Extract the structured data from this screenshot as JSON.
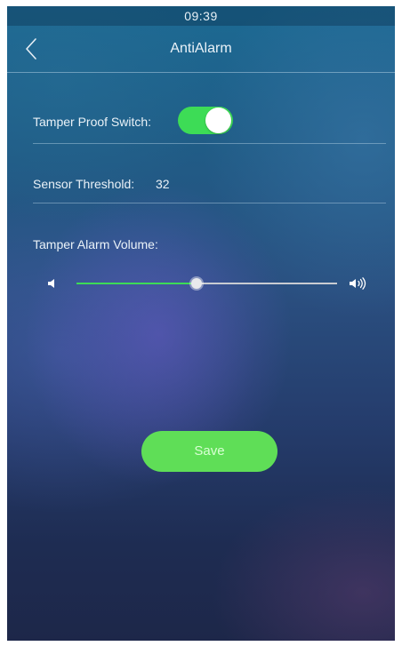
{
  "status_bar": {
    "time": "09:39"
  },
  "header": {
    "title": "AntiAlarm",
    "back_icon": "chevron-left-icon"
  },
  "tamper": {
    "label": "Tamper Proof Switch:",
    "enabled": true
  },
  "threshold": {
    "label": "Sensor Threshold:",
    "value": "32"
  },
  "volume": {
    "label": "Tamper Alarm Volume:",
    "level_fraction": 0.46,
    "low_icon": "volume-low-icon",
    "high_icon": "volume-high-icon"
  },
  "save": {
    "label": "Save"
  },
  "colors": {
    "accent_green": "#3ddc56",
    "save_green": "#5fde57",
    "track_gray": "#c9ccd2",
    "text": "#eaf2f8"
  }
}
